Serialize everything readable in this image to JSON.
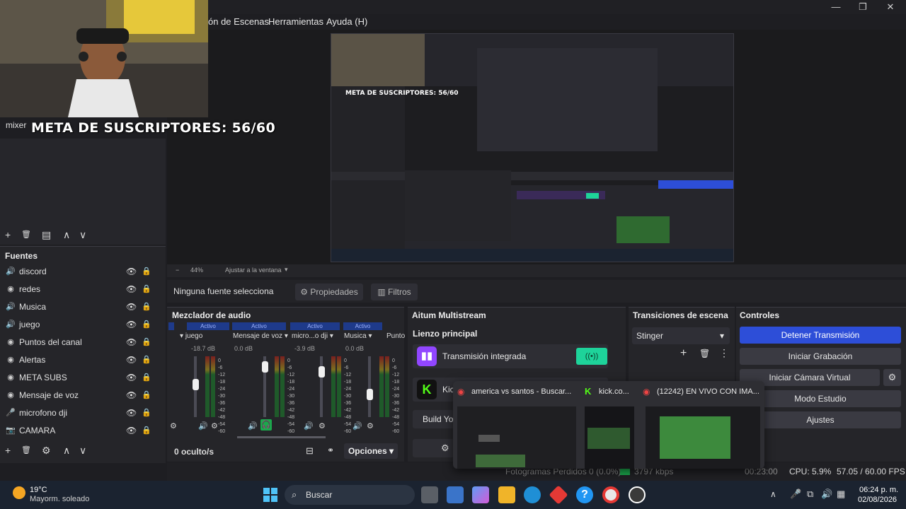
{
  "app": {
    "menus": [
      "ón de Escenas",
      "Herramientas",
      "Ayuda (H)"
    ],
    "window_controls": [
      "—",
      "❐",
      "✕"
    ]
  },
  "overlay": {
    "webcam_label": "mixer",
    "meta_text": "META DE SUSCRIPTORES: 56/60"
  },
  "preview": {
    "zoom": "44%",
    "zoom_mode": "Ajustar a la ventana"
  },
  "scene_toolbar": [
    "+",
    "🗑",
    "▤",
    "∧",
    "∨"
  ],
  "sources": {
    "title": "Fuentes",
    "items": [
      {
        "icon": "speaker-icon",
        "glyph": "🔊",
        "label": "discord"
      },
      {
        "icon": "globe-icon",
        "glyph": "◉",
        "label": "redes"
      },
      {
        "icon": "speaker-icon",
        "glyph": "🔊",
        "label": "Musica"
      },
      {
        "icon": "speaker-icon",
        "glyph": "🔊",
        "label": "juego"
      },
      {
        "icon": "globe-icon",
        "glyph": "◉",
        "label": "Puntos del canal"
      },
      {
        "icon": "globe-icon",
        "glyph": "◉",
        "label": "Alertas"
      },
      {
        "icon": "globe-icon",
        "glyph": "◉",
        "label": "META SUBS"
      },
      {
        "icon": "globe-icon",
        "glyph": "◉",
        "label": "Mensaje de voz"
      },
      {
        "icon": "mic-icon",
        "glyph": "🎤",
        "label": "microfono dji"
      },
      {
        "icon": "camera-icon",
        "glyph": "📷",
        "label": "CAMARA"
      }
    ]
  },
  "properties_bar": {
    "no_source": "Ninguna fuente selecciona",
    "properties": "Propiedades",
    "filters": "Filtros"
  },
  "mixer": {
    "title": "Mezclador de audio",
    "active_label": "Activo",
    "channels": [
      {
        "name": "juego",
        "db": "-18.7 dB",
        "level": 0.55
      },
      {
        "name": "Mensaje de voz",
        "db": "0.0 dB",
        "level": 0.9
      },
      {
        "name": "micro...o dji",
        "db": "-3.9 dB",
        "level": 0.8
      },
      {
        "name": "Musica",
        "db": "0.0 dB",
        "level": 0.35
      },
      {
        "name": "Punto",
        "db": "",
        "level": 0.9
      }
    ],
    "scale": [
      "0",
      "-6",
      "-12",
      "-18",
      "-24",
      "-30",
      "-36",
      "-42",
      "-48",
      "-54",
      "-60"
    ],
    "hidden_count": "0 oculto/s",
    "options": "Opciones"
  },
  "multistream": {
    "title": "Aitum Multistream",
    "main_canvas": "Lienzo principal",
    "twitch_label": "Transmisión integrada",
    "kick_label": "Kic",
    "build_label": "Build You"
  },
  "transitions": {
    "title": "Transiciones de escena",
    "selected": "Stinger"
  },
  "controls": {
    "title": "Controles",
    "buttons": [
      "Detener Transmisión",
      "Iniciar Grabación",
      "Iniciar Cámara Virtual",
      "Modo Estudio",
      "Ajustes"
    ]
  },
  "popup": {
    "tabs": [
      {
        "icon": "chrome-icon",
        "title": "america vs santos - Buscar..."
      },
      {
        "icon": "kick-icon",
        "title": "kick.co..."
      },
      {
        "icon": "chrome-icon",
        "title": "(12242) EN VIVO CON IMA..."
      }
    ]
  },
  "status": {
    "frames": "Fotogramas Perdidos 0 (0.0%)",
    "kbps": "3797 kbps",
    "time": "00:23:00",
    "cpu": "CPU: 5.9%",
    "fps": "57.05 / 60.00 FPS"
  },
  "taskbar": {
    "temp": "19°C",
    "weather": "Mayorm. soleado",
    "search": "Buscar",
    "clock": "06:24 p. m.",
    "date": "02/08/2026"
  },
  "colors": {
    "accent_blue": "#2d4ed8",
    "green_toggle": "#1ed39a",
    "twitch": "#9146ff",
    "kick": "#53fc18"
  }
}
